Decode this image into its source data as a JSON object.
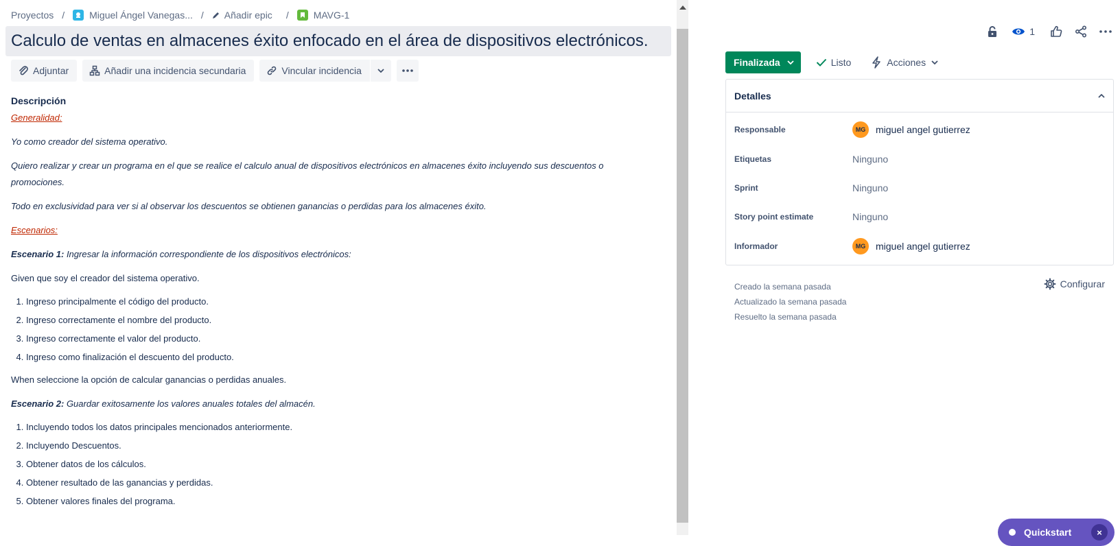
{
  "breadcrumb": {
    "projects": "Proyectos",
    "project": "Miguel Ángel Vanegas...",
    "epic": "Añadir epic",
    "issue_key": "MAVG-1"
  },
  "issue": {
    "title": "Calculo de ventas en almacenes éxito enfocado en el área de dispositivos electrónicos."
  },
  "toolbar": {
    "attach": "Adjuntar",
    "add_child": "Añadir una incidencia secundaria",
    "link_issue": "Vincular incidencia"
  },
  "description": {
    "label": "Descripción",
    "generalidad": "Generalidad:",
    "p1": "Yo como creador del sistema operativo.",
    "p2": "Quiero realizar y crear un programa en el que se realice el calculo anual de dispositivos electrónicos en almacenes éxito incluyendo sus descuentos o promociones.",
    "p3": "Todo en exclusividad para ver si al observar los descuentos se obtienen ganancias o perdidas para los almacenes éxito.",
    "escenarios": "Escenarios:",
    "scenario1_label": "Escenario 1:",
    "scenario1_text": " Ingresar la información correspondiente de los dispositivos electrónicos:",
    "given": "Given que soy el creador del sistema operativo.",
    "list1": [
      "Ingreso principalmente el código del producto.",
      "Ingreso correctamente el nombre del producto.",
      "Ingreso correctamente el valor del producto.",
      "Ingreso como finalización el descuento del producto."
    ],
    "when": "When seleccione la opción de calcular ganancias o perdidas anuales.",
    "scenario2_label": "Escenario 2:",
    "scenario2_text": " Guardar exitosamente los valores anuales totales del almacén.",
    "list2": [
      "Incluyendo todos los datos principales mencionados anteriormente.",
      "Incluyendo Descuentos.",
      "Obtener datos de los cálculos.",
      "Obtener resultado de las ganancias y perdidas.",
      "Obtener valores finales del programa."
    ]
  },
  "actions": {
    "watch_count": "1"
  },
  "status": {
    "label": "Finalizada",
    "done_label": "Listo",
    "actions_label": "Acciones",
    "status_color": "#00875a"
  },
  "details": {
    "header": "Detalles",
    "rows": [
      {
        "label": "Responsable",
        "value": "miguel angel gutierrez",
        "avatar": "MG"
      },
      {
        "label": "Etiquetas",
        "value": "Ninguno"
      },
      {
        "label": "Sprint",
        "value": "Ninguno"
      },
      {
        "label": "Story point estimate",
        "value": "Ninguno"
      },
      {
        "label": "Informador",
        "value": "miguel angel gutierrez",
        "avatar": "MG"
      }
    ]
  },
  "meta": {
    "created": "Creado la semana pasada",
    "updated": "Actualizado la semana pasada",
    "resolved": "Resuelto la semana pasada",
    "configure": "Configurar"
  },
  "quickstart": {
    "label": "Quickstart",
    "close": "×",
    "color": "#6554c0"
  }
}
